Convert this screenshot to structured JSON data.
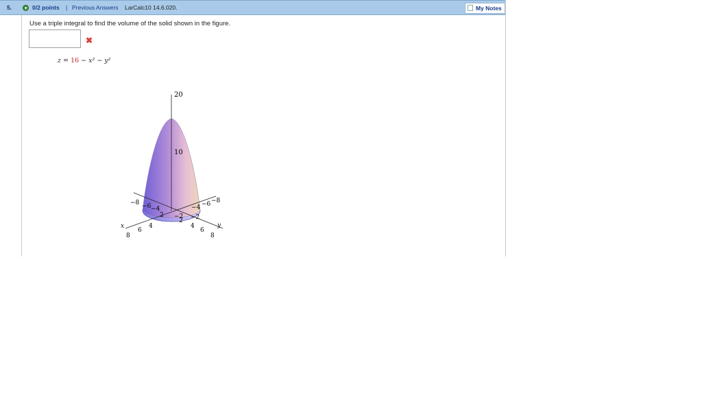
{
  "header": {
    "question_number": "5.",
    "points": "0/2 points",
    "separator": "|",
    "previous_answers": "Previous Answers",
    "source": "LarCalc10 14.6.020.",
    "my_notes": "My Notes"
  },
  "question": {
    "prompt": "Use a triple integral to find the volume of the solid shown in the figure.",
    "answer_value": "",
    "status_icon": "x-mark-icon"
  },
  "equation": {
    "lhs": "z =",
    "constant": "16",
    "rest": "− x² − y²"
  },
  "figure": {
    "z_ticks": [
      "20",
      "10"
    ],
    "x_axis_label": "x",
    "y_axis_label": "y",
    "x_ticks_near": [
      "8",
      "6",
      "4"
    ],
    "y_ticks_near": [
      "4",
      "6",
      "8"
    ],
    "neg_ticks_left": [
      "−8",
      "−6",
      "−4"
    ],
    "neg_ticks_right": [
      "−4",
      "−6",
      "−8"
    ],
    "base_ticks": [
      "2",
      "−2",
      "2",
      "−2"
    ],
    "colors": {
      "surface_left": "#6f5fd6",
      "surface_right": "#f0c8c0",
      "base": "#8f86e6"
    }
  }
}
